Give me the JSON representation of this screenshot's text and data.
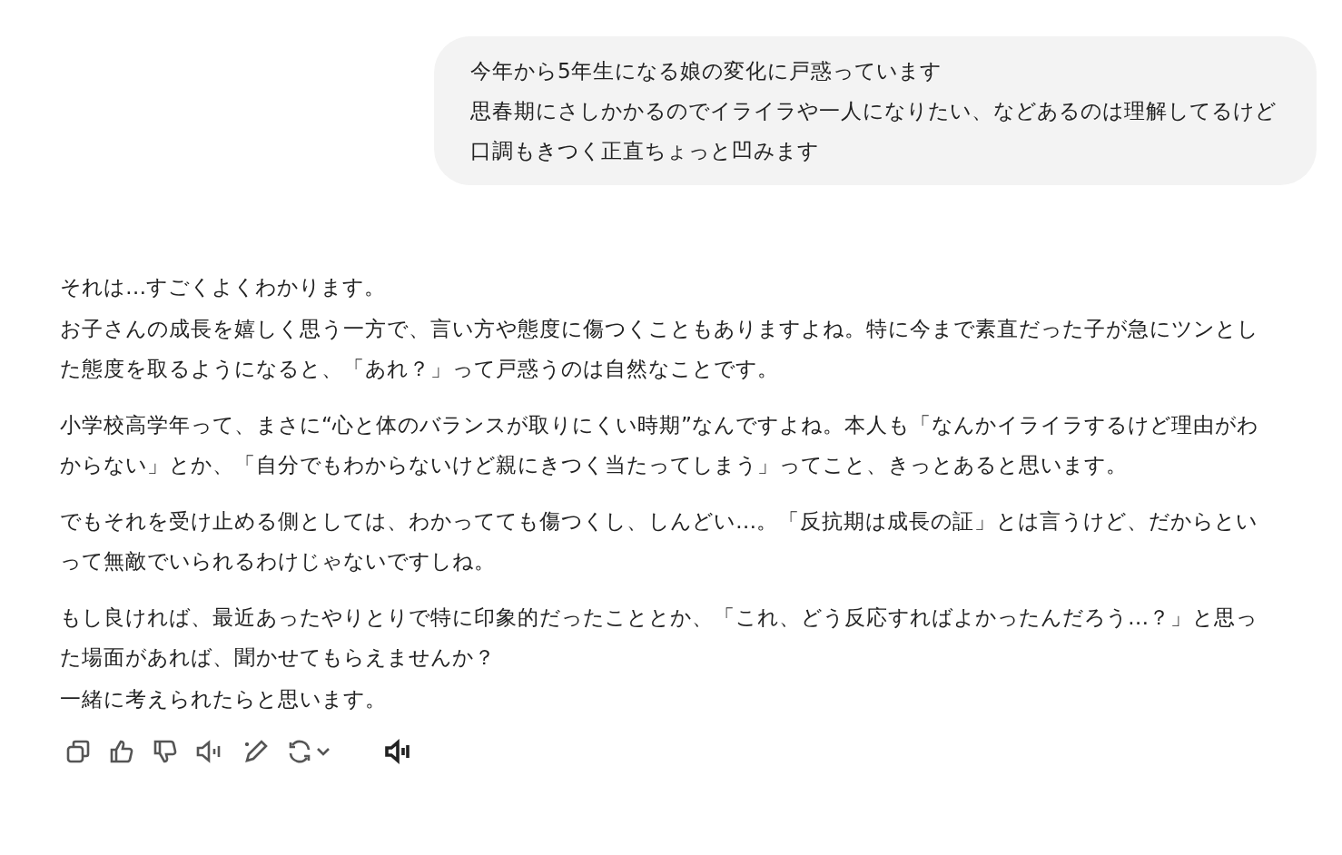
{
  "user_message": {
    "lines": [
      "今年から5年生になる娘の変化に戸惑っています",
      "思春期にさしかかるのでイライラや一人になりたい、などあるのは理解してるけど",
      "口調もきつく正直ちょっと凹みます"
    ]
  },
  "assistant_message": {
    "paragraphs": [
      {
        "lines": [
          "それは…すごくよくわかります。",
          "お子さんの成長を嬉しく思う一方で、言い方や態度に傷つくこともありますよね。特に今まで素直だった子が急にツンとした態度を取るようになると、「あれ？」って戸惑うのは自然なことです。"
        ]
      },
      {
        "lines": [
          "小学校高学年って、まさに“心と体のバランスが取りにくい時期”なんですよね。本人も「なんかイライラするけど理由がわからない」とか、「自分でもわからないけど親にきつく当たってしまう」ってこと、きっとあると思います。"
        ]
      },
      {
        "lines": [
          "でもそれを受け止める側としては、わかってても傷つくし、しんどい…。「反抗期は成長の証」とは言うけど、だからといって無敵でいられるわけじゃないですしね。"
        ]
      },
      {
        "lines": [
          "もし良ければ、最近あったやりとりで特に印象的だったこととか、「これ、どう反応すればよかったんだろう…？」と思った場面があれば、聞かせてもらえませんか？",
          "一緒に考えられたらと思います。"
        ]
      }
    ]
  },
  "actions": [
    {
      "kind": "copy"
    },
    {
      "kind": "like"
    },
    {
      "kind": "dislike"
    },
    {
      "kind": "read"
    },
    {
      "kind": "edit"
    },
    {
      "kind": "regenerate"
    },
    {
      "kind": "voice"
    }
  ]
}
